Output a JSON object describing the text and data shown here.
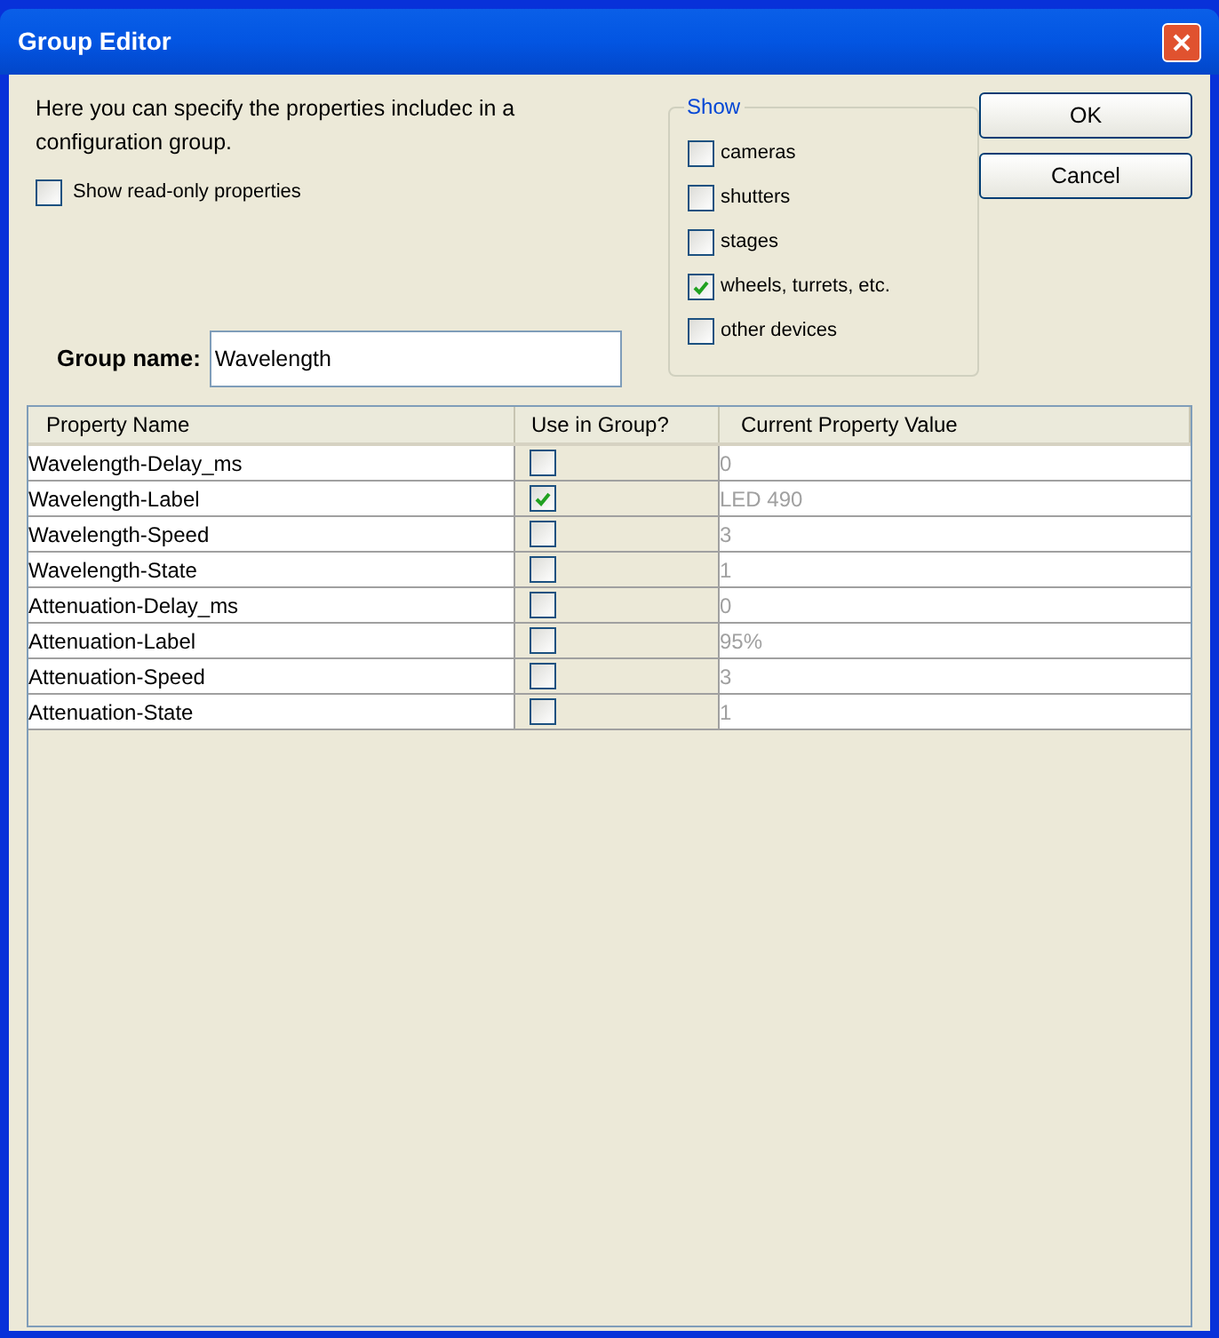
{
  "window": {
    "title": "Group Editor"
  },
  "description": "Here you can specify the properties includec in a configuration group.",
  "show_read_only": {
    "label": "Show read-only properties",
    "checked": false
  },
  "group_name": {
    "label": "Group name:",
    "value": "Wavelength"
  },
  "show": {
    "title": "Show",
    "options": [
      {
        "label": "cameras",
        "checked": false
      },
      {
        "label": "shutters",
        "checked": false
      },
      {
        "label": "stages",
        "checked": false
      },
      {
        "label": "wheels, turrets, etc.",
        "checked": true
      },
      {
        "label": "other devices",
        "checked": false
      }
    ]
  },
  "buttons": [
    "OK",
    "Cancel"
  ],
  "table": {
    "columns": [
      "Property Name",
      "Use in Group?",
      "Current Property Value"
    ],
    "rows": [
      {
        "name": "Wavelength-Delay_ms",
        "checked": false,
        "value": "0"
      },
      {
        "name": "Wavelength-Label",
        "checked": true,
        "value": "LED 490"
      },
      {
        "name": "Wavelength-Speed",
        "checked": false,
        "value": "3"
      },
      {
        "name": "Wavelength-State",
        "checked": false,
        "value": "1"
      },
      {
        "name": "Attenuation-Delay_ms",
        "checked": false,
        "value": "0"
      },
      {
        "name": "Attenuation-Label",
        "checked": false,
        "value": "95%"
      },
      {
        "name": "Attenuation-Speed",
        "checked": false,
        "value": "3"
      },
      {
        "name": "Attenuation-State",
        "checked": false,
        "value": "1"
      }
    ]
  }
}
